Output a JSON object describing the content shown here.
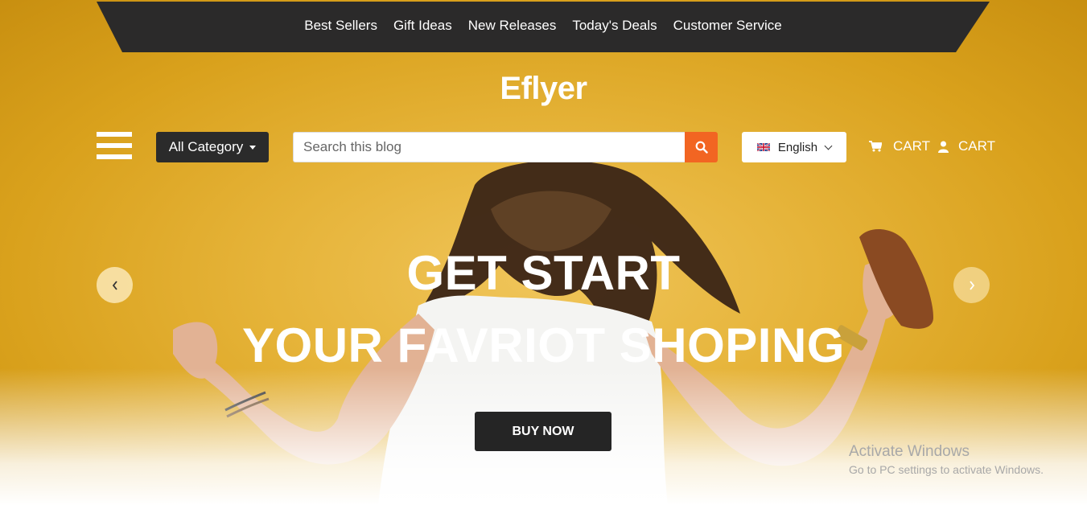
{
  "topnav": {
    "links": [
      "Best Sellers",
      "Gift Ideas",
      "New Releases",
      "Today's Deals",
      "Customer Service"
    ]
  },
  "logo": "Eflyer",
  "toolbar": {
    "category_label": "All Category",
    "search_placeholder": "Search this blog",
    "language": "English",
    "cart_label_1": "CART",
    "cart_label_2": "CART"
  },
  "hero": {
    "headline_1": "GET START",
    "headline_2": "YOUR FAVRIOT SHOPING",
    "buy_button": "BUY NOW"
  },
  "watermark": {
    "title": "Activate Windows",
    "subtitle": "Go to PC settings to activate Windows."
  },
  "colors": {
    "accent": "#f26522",
    "dark": "#2b2b2b",
    "hero_bg": "#e6b43a"
  }
}
